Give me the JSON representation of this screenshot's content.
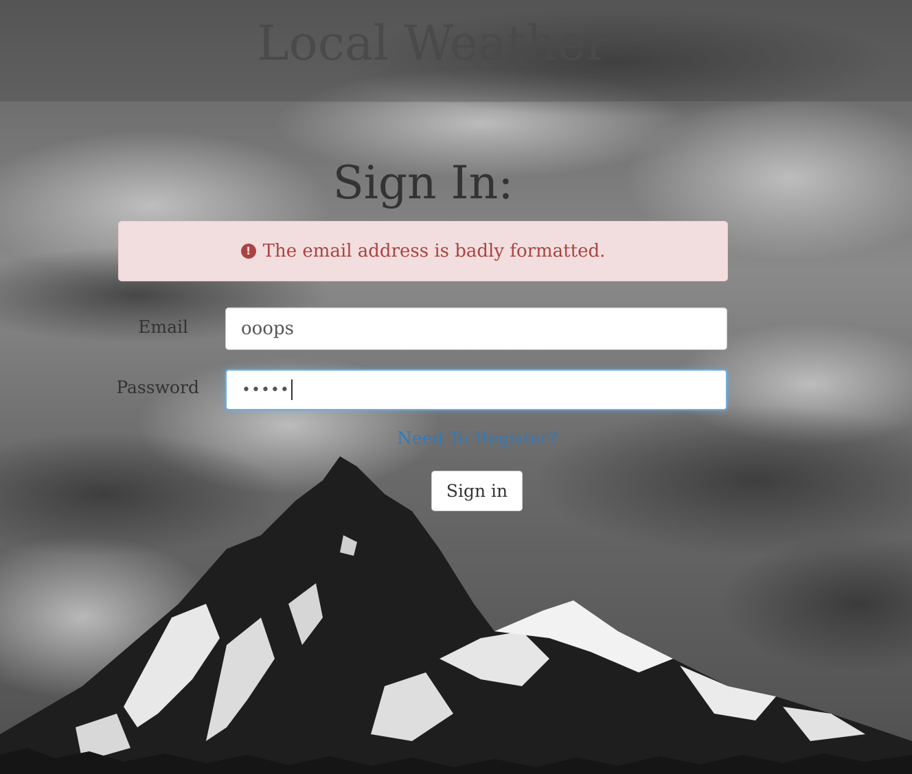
{
  "header": {
    "title": "Local Weather"
  },
  "form": {
    "heading": "Sign In:",
    "alert": {
      "icon": "exclamation-circle-icon",
      "message": "The email address is badly formatted."
    },
    "email": {
      "label": "Email",
      "value": "ooops"
    },
    "password": {
      "label": "Password",
      "masked_value": "•••••"
    },
    "register_link": "Need To Register?",
    "submit_label": "Sign in"
  },
  "colors": {
    "alert_bg": "#f2dede",
    "alert_text": "#a94442",
    "link": "#337ab7",
    "focus_border": "#66afe9"
  }
}
